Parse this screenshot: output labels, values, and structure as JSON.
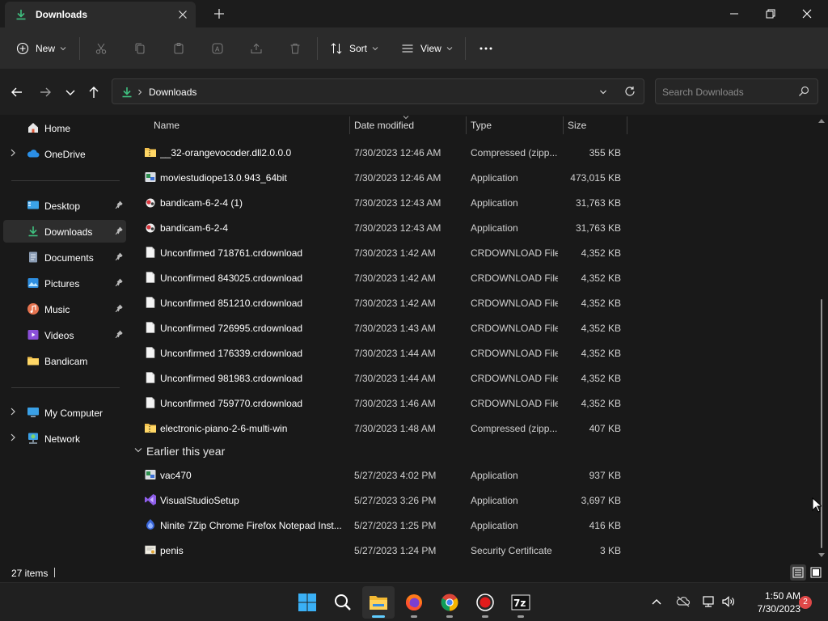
{
  "window": {
    "tab_title": "Downloads"
  },
  "toolbar": {
    "new_label": "New",
    "sort_label": "Sort",
    "view_label": "View"
  },
  "address": {
    "path": "Downloads",
    "search_placeholder": "Search Downloads"
  },
  "sidebar": {
    "home": "Home",
    "onedrive": "OneDrive",
    "desktop": "Desktop",
    "downloads": "Downloads",
    "documents": "Documents",
    "pictures": "Pictures",
    "music": "Music",
    "videos": "Videos",
    "bandicam": "Bandicam",
    "my_computer": "My Computer",
    "network": "Network"
  },
  "columns": {
    "name": "Name",
    "date": "Date modified",
    "type": "Type",
    "size": "Size"
  },
  "files": [
    {
      "name": "__32-orangevocoder.dll2.0.0.0",
      "date": "7/30/2023 12:46 AM",
      "type": "Compressed (zipp...",
      "size": "355 KB",
      "icon": "zip-folder-icon"
    },
    {
      "name": "moviestudiope13.0.943_64bit",
      "date": "7/30/2023 12:46 AM",
      "type": "Application",
      "size": "473,015 KB",
      "icon": "installer-icon"
    },
    {
      "name": "bandicam-6-2-4 (1)",
      "date": "7/30/2023 12:43 AM",
      "type": "Application",
      "size": "31,763 KB",
      "icon": "bandicam-app-icon"
    },
    {
      "name": "bandicam-6-2-4",
      "date": "7/30/2023 12:43 AM",
      "type": "Application",
      "size": "31,763 KB",
      "icon": "bandicam-app-icon"
    },
    {
      "name": "Unconfirmed 718761.crdownload",
      "date": "7/30/2023 1:42 AM",
      "type": "CRDOWNLOAD File",
      "size": "4,352 KB",
      "icon": "file-icon"
    },
    {
      "name": "Unconfirmed 843025.crdownload",
      "date": "7/30/2023 1:42 AM",
      "type": "CRDOWNLOAD File",
      "size": "4,352 KB",
      "icon": "file-icon"
    },
    {
      "name": "Unconfirmed 851210.crdownload",
      "date": "7/30/2023 1:42 AM",
      "type": "CRDOWNLOAD File",
      "size": "4,352 KB",
      "icon": "file-icon"
    },
    {
      "name": "Unconfirmed 726995.crdownload",
      "date": "7/30/2023 1:43 AM",
      "type": "CRDOWNLOAD File",
      "size": "4,352 KB",
      "icon": "file-icon"
    },
    {
      "name": "Unconfirmed 176339.crdownload",
      "date": "7/30/2023 1:44 AM",
      "type": "CRDOWNLOAD File",
      "size": "4,352 KB",
      "icon": "file-icon"
    },
    {
      "name": "Unconfirmed 981983.crdownload",
      "date": "7/30/2023 1:44 AM",
      "type": "CRDOWNLOAD File",
      "size": "4,352 KB",
      "icon": "file-icon"
    },
    {
      "name": "Unconfirmed 759770.crdownload",
      "date": "7/30/2023 1:46 AM",
      "type": "CRDOWNLOAD File",
      "size": "4,352 KB",
      "icon": "file-icon"
    },
    {
      "name": "electronic-piano-2-6-multi-win",
      "date": "7/30/2023 1:48 AM",
      "type": "Compressed (zipp...",
      "size": "407 KB",
      "icon": "zip-folder-icon"
    }
  ],
  "group_earlier": "Earlier this year",
  "files_earlier": [
    {
      "name": "vac470",
      "date": "5/27/2023 4:02 PM",
      "type": "Application",
      "size": "937 KB",
      "icon": "installer-icon"
    },
    {
      "name": "VisualStudioSetup",
      "date": "5/27/2023 3:26 PM",
      "type": "Application",
      "size": "3,697 KB",
      "icon": "visual-studio-icon"
    },
    {
      "name": "Ninite 7Zip Chrome Firefox Notepad Inst...",
      "date": "5/27/2023 1:25 PM",
      "type": "Application",
      "size": "416 KB",
      "icon": "ninite-icon"
    },
    {
      "name": "penis",
      "date": "5/27/2023 1:24 PM",
      "type": "Security Certificate",
      "size": "3 KB",
      "icon": "certificate-icon"
    }
  ],
  "status": {
    "items": "27 items"
  },
  "taskbar": {
    "time": "1:50 AM",
    "date": "7/30/2023",
    "notifications": "2"
  }
}
